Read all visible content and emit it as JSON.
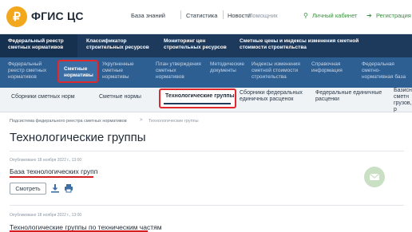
{
  "header": {
    "brand": "ФГИС ЦС",
    "logo_letter": "₽",
    "nav": [
      "База знаний",
      "Статистика",
      "Новости",
      "Помощник"
    ],
    "cabinet": "Личный кабинет",
    "register": "Регистрация"
  },
  "main_nav": [
    {
      "label": "Федеральный реестр сметных нормативов"
    },
    {
      "label": "Классификатор строительных ресурсов"
    },
    {
      "label": "Мониторинг цен строительных ресурсов"
    },
    {
      "label": "Сметные цены и индексы изменения сметной стоимости строительства"
    }
  ],
  "sub_nav": [
    {
      "label": "Федеральный реестр сметных нормативов"
    },
    {
      "label": "Сметные нормативы"
    },
    {
      "label": "Укрупненные сметные нормативы"
    },
    {
      "label": "План утверждения сметных нормативов"
    },
    {
      "label": "Методические документы"
    },
    {
      "label": "Индексы изменения сметной стоимости строительства"
    },
    {
      "label": "Справочная информация"
    },
    {
      "label": "Федеральная сметно-нормативная база"
    }
  ],
  "tabs": [
    {
      "label": "Сборники сметных норм"
    },
    {
      "label": "Сметные нормы"
    },
    {
      "label": "Технологические группы"
    },
    {
      "label": "Сборники федеральных единичных расценок"
    },
    {
      "label": "Федеральные единичные расценки"
    },
    {
      "label": "Базисн сметн грузов, р"
    }
  ],
  "breadcrumb": {
    "parent": "Подсистема федерального реестра сметных нормативов",
    "separator": ">",
    "current": "Технологические группы"
  },
  "page_title": "Технологические группы",
  "documents": [
    {
      "meta": "Опубликовано 18 ноября 2022 г., 13:00",
      "title": "База технологических групп",
      "open_label": "Смотреть"
    },
    {
      "meta": "Опубликовано 18 ноября 2022 г., 13:00",
      "title": "Технологические группы по техническим частям"
    }
  ],
  "icons": {
    "download": "download-icon",
    "print": "print-icon",
    "chat": "chat-icon",
    "user": "user-icon",
    "login": "login-icon"
  },
  "colors": {
    "dark_nav": "#1d3a5c",
    "blue_nav": "#2e5f93",
    "highlight": "#e0282d",
    "accent_green": "#3b8f3e",
    "logo": "#f3a71d"
  }
}
